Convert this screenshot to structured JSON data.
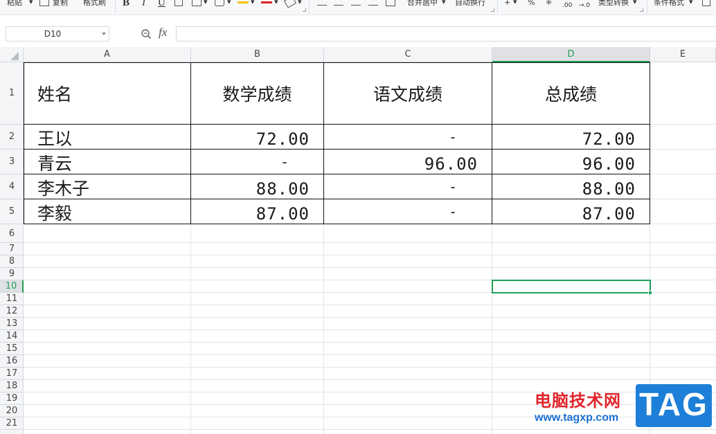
{
  "ribbon": {
    "paste_label": "粘贴",
    "copy_label": "复制",
    "format_painter_label": "格式刷",
    "bold_label": "B",
    "italic_label": "I",
    "underline_label": "U",
    "merge_center_label": "合并居中",
    "wrap_text_label": "自动换行",
    "percent_label": "%",
    "decimal_increase_label": ".00",
    "decimal_decrease_label": "→.0",
    "type_convert_label": "类型转换",
    "conditional_format_label": "条件格式",
    "highlight_color": "#f5c400",
    "font_color": "#e02020"
  },
  "formula_bar": {
    "name_box": "D10",
    "fx_label": "fx",
    "formula": ""
  },
  "columns": [
    "A",
    "B",
    "C",
    "D",
    "E"
  ],
  "active_column": "D",
  "rows": [
    "1",
    "2",
    "3",
    "4",
    "5",
    "6",
    "7",
    "8",
    "9",
    "10",
    "11",
    "12",
    "13",
    "14",
    "15",
    "16",
    "17",
    "18",
    "19",
    "20",
    "21"
  ],
  "active_row": "10",
  "table": {
    "headers": [
      "姓名",
      "数学成绩",
      "语文成绩",
      "总成绩"
    ],
    "rows": [
      [
        "王以",
        "72.00",
        "-",
        "72.00"
      ],
      [
        "青云",
        "-",
        "96.00",
        "96.00"
      ],
      [
        "李木子",
        "88.00",
        "-",
        "88.00"
      ],
      [
        "李毅",
        "87.00",
        "-",
        "87.00"
      ]
    ]
  },
  "colors": {
    "accent": "#1f9d55",
    "header_bg": "#f4f5f7",
    "gridline": "#e1e4e8"
  },
  "watermark": {
    "site_name": "电脑技术网",
    "url": "www.tagxp.com",
    "logo_text": "TAG"
  }
}
